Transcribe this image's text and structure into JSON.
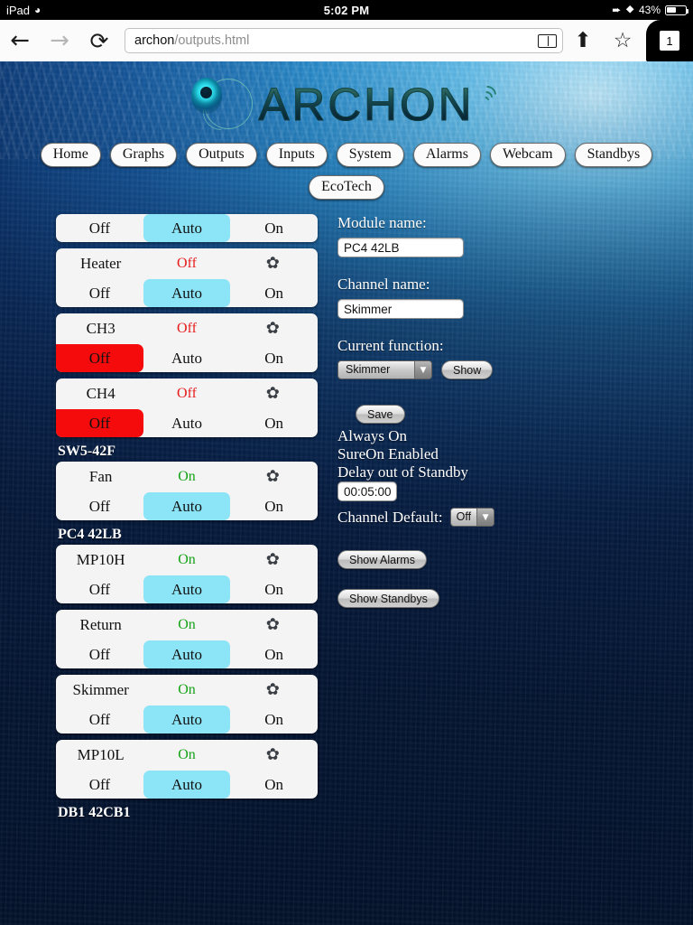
{
  "status_bar": {
    "carrier": "iPad",
    "wifi_icon": "wifi-icon",
    "time": "5:02 PM",
    "location_icon": "location-arrow-icon",
    "bluetooth_icon": "bluetooth-icon",
    "battery_percent": "43%"
  },
  "browser": {
    "back_icon": "←",
    "forward_icon": "→",
    "reload_icon": "⟳",
    "url_host": "archon",
    "url_path": "/outputs.html",
    "reader_icon": "reader-icon",
    "share_icon": "⬆",
    "bookmark_icon": "☆",
    "tab_count": "1"
  },
  "logo": {
    "text": "ARCHON"
  },
  "nav": {
    "row1": [
      "Home",
      "Graphs",
      "Outputs",
      "Inputs",
      "System",
      "Alarms",
      "Webcam",
      "Standbys"
    ],
    "row2": [
      "EcoTech"
    ]
  },
  "buttons": {
    "off": "Off",
    "auto": "Auto",
    "on": "On"
  },
  "gear_icon": "✿",
  "channels": [
    {
      "partial": true,
      "name": "",
      "state": "",
      "selected": "auto"
    },
    {
      "partial": false,
      "name": "Heater",
      "state": "Off",
      "state_kind": "off",
      "selected": "auto"
    },
    {
      "partial": false,
      "name": "CH3",
      "state": "Off",
      "state_kind": "off",
      "selected": "off"
    },
    {
      "partial": false,
      "name": "CH4",
      "state": "Off",
      "state_kind": "off",
      "selected": "off"
    }
  ],
  "groups": [
    {
      "title": "SW5-42F",
      "channels": [
        {
          "name": "Fan",
          "state": "On",
          "state_kind": "on",
          "selected": "auto"
        }
      ]
    },
    {
      "title": "PC4 42LB",
      "channels": [
        {
          "name": "MP10H",
          "state": "On",
          "state_kind": "on",
          "selected": "auto"
        },
        {
          "name": "Return",
          "state": "On",
          "state_kind": "on",
          "selected": "auto"
        },
        {
          "name": "Skimmer",
          "state": "On",
          "state_kind": "on",
          "selected": "auto"
        },
        {
          "name": "MP10L",
          "state": "On",
          "state_kind": "on",
          "selected": "auto"
        }
      ]
    }
  ],
  "bottom_group_title": "DB1 42CB1",
  "form": {
    "module_name_label": "Module name:",
    "module_name_value": "PC4 42LB",
    "channel_name_label": "Channel name:",
    "channel_name_value": "Skimmer",
    "current_function_label": "Current function:",
    "current_function_value": "Skimmer",
    "show_button": "Show",
    "save_button": "Save",
    "option_always_on": "Always On",
    "option_sureon": "SureOn Enabled",
    "option_delay": "Delay out of Standby",
    "delay_value": "00:05:00",
    "channel_default_label": "Channel Default:",
    "channel_default_value": "Off",
    "show_alarms_button": "Show Alarms",
    "show_standbys_button": "Show Standbys",
    "dropdown_arrow": "▼"
  },
  "colors": {
    "auto_selected": "#8ce4f7",
    "off_selected": "#f50b0b",
    "state_on": "#17a317",
    "state_off": "#e81b1b"
  }
}
